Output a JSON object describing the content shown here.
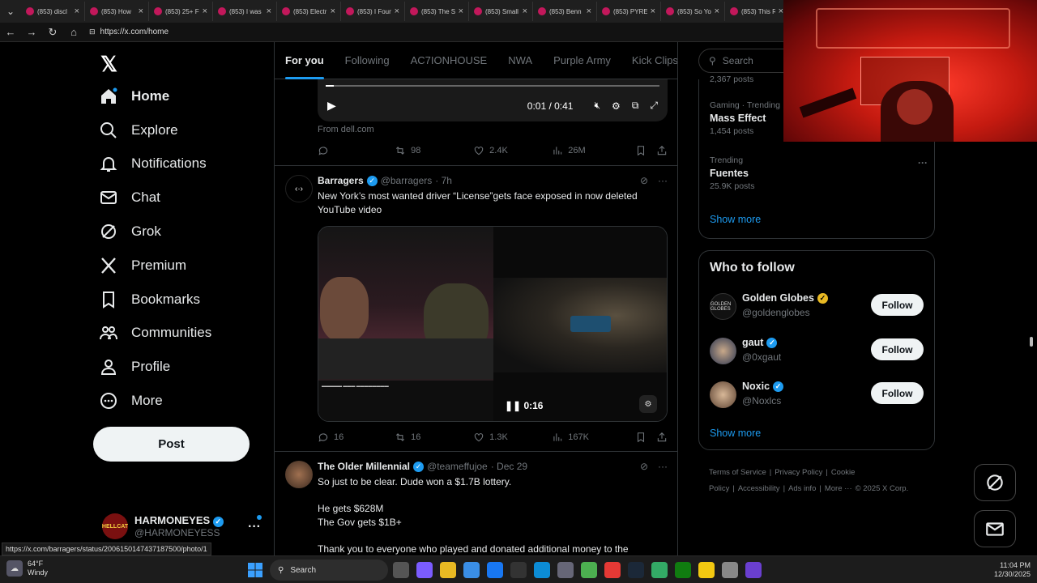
{
  "browser": {
    "tabs": [
      {
        "title": "(853) discl"
      },
      {
        "title": "(853) How"
      },
      {
        "title": "(853) 25+ F"
      },
      {
        "title": "(853) I was"
      },
      {
        "title": "(853) Electr"
      },
      {
        "title": "(853) I Foun"
      },
      {
        "title": "(853) The S"
      },
      {
        "title": "(853) Small"
      },
      {
        "title": "(853) Benn"
      },
      {
        "title": "(853) PYRE"
      },
      {
        "title": "(853) So Yo"
      },
      {
        "title": "(853) This R"
      }
    ],
    "url": "https://x.com/home",
    "status_url": "https://x.com/barragers/status/2006150147437187500/photo/1"
  },
  "sidebar": {
    "logo": "𝕏",
    "items": [
      {
        "label": "Home",
        "icon": "home-icon",
        "active": true
      },
      {
        "label": "Explore",
        "icon": "search-icon"
      },
      {
        "label": "Notifications",
        "icon": "bell-icon"
      },
      {
        "label": "Chat",
        "icon": "mail-icon"
      },
      {
        "label": "Grok",
        "icon": "grok-icon"
      },
      {
        "label": "Premium",
        "icon": "x-icon"
      },
      {
        "label": "Bookmarks",
        "icon": "bookmark-icon"
      },
      {
        "label": "Communities",
        "icon": "people-icon"
      },
      {
        "label": "Profile",
        "icon": "person-icon"
      },
      {
        "label": "More",
        "icon": "more-circle-icon"
      }
    ],
    "post_label": "Post",
    "account": {
      "avatar_text": "HELLCAT",
      "name": "HARMONEYES",
      "handle": "@HARMONEYESS"
    }
  },
  "feed": {
    "tabs": [
      "For you",
      "Following",
      "AC7IONHOUSE",
      "NWA",
      "Purple Army",
      "Kick Clips"
    ],
    "active_tab": "For you",
    "first_tweet": {
      "time": "0:01 / 0:41",
      "from": "From dell.com",
      "retweets": "98",
      "likes": "2.4K",
      "views": "26M"
    },
    "second_tweet": {
      "name": "Barragers",
      "handle": "@barragers",
      "time": "· 7h",
      "text": "New York’s most wanted driver “License”gets face exposed in now deleted YouTube video",
      "video_time": "0:16",
      "replies": "16",
      "retweets": "16",
      "likes": "1.3K",
      "views": "167K"
    },
    "third_tweet": {
      "name": "The Older Millennial",
      "handle": "@teameffujoe",
      "time": "· Dec 29",
      "line1": "So just to be clear. Dude won a $1.7B lottery.",
      "line2": "He gets $628M",
      "line3": "The Gov gets $1B+",
      "line4": "Thank you to everyone who played and donated additional money to the"
    }
  },
  "right": {
    "search_placeholder": "Search",
    "trends": [
      {
        "category": "",
        "title": "",
        "posts": "2,367 posts"
      },
      {
        "category": "Gaming · Trending",
        "title": "Mass Effect",
        "posts": "1,454 posts"
      },
      {
        "category": "Trending",
        "title": "Fuentes",
        "posts": "25.9K posts"
      }
    ],
    "show_more": "Show more",
    "who_to_follow": {
      "title": "Who to follow",
      "users": [
        {
          "name": "Golden Globes",
          "handle": "@goldenglobes",
          "verified": "gold",
          "avatar": "GOLDEN GLOBES"
        },
        {
          "name": "gaut",
          "handle": "@0xgaut",
          "verified": "blue",
          "avatar": ""
        },
        {
          "name": "Noxic",
          "handle": "@Noxlcs",
          "verified": "blue",
          "avatar": ""
        }
      ],
      "follow_label": "Follow",
      "show_more": "Show more"
    },
    "footer": [
      "Terms of Service",
      "|",
      "Privacy Policy",
      "|",
      "Cookie Policy",
      "|",
      "Accessibility",
      "|",
      "Ads info",
      "|",
      "More ···",
      "© 2025 X Corp."
    ]
  },
  "taskbar": {
    "temp": "64°F",
    "condition": "Windy",
    "search": "Search",
    "time": "11:04 PM",
    "date": "12/30/2025"
  },
  "colors": {
    "accent": "#1d9bf0",
    "bg": "#000000",
    "text": "#e7e9ea",
    "muted": "#71767b"
  }
}
